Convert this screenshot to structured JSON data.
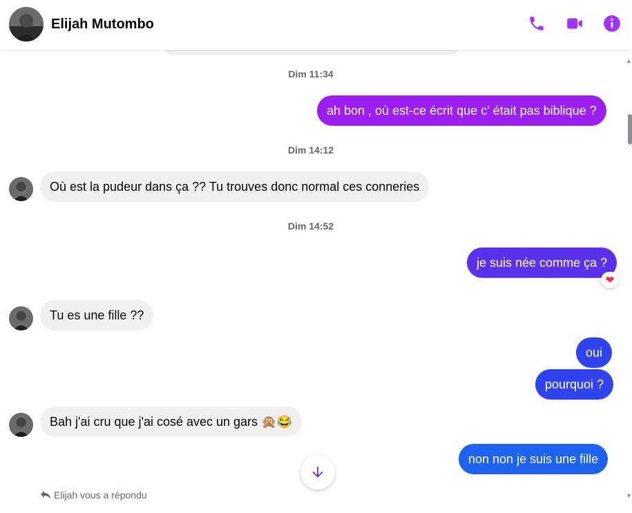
{
  "header": {
    "contact_name": "Elijah Mutombo",
    "accent_color": "#a033ff"
  },
  "messages": [
    {
      "kind": "timestamp",
      "text": "Dim 11:34"
    },
    {
      "kind": "out",
      "text": "ah bon , où est-ce écrit que c' était pas biblique ?",
      "color": "#9d1ef0"
    },
    {
      "kind": "timestamp",
      "text": "Dim 14:12"
    },
    {
      "kind": "in",
      "text": "Où est la pudeur dans ça ?? Tu trouves donc normal ces conneries"
    },
    {
      "kind": "timestamp",
      "text": "Dim 14:52"
    },
    {
      "kind": "out",
      "text": "je suis née comme ça ?",
      "color": "#5b31ee",
      "reaction": "heart"
    },
    {
      "kind": "in",
      "text": "Tu es une fille ??"
    },
    {
      "kind": "out",
      "text": "oui",
      "color": "#2f44f0"
    },
    {
      "kind": "out",
      "text": "pourquoi ?",
      "color": "#2f44f0"
    },
    {
      "kind": "in",
      "text": "Bah j'ai cru que j'ai cosé avec un gars",
      "emojis": "🙊😂"
    },
    {
      "kind": "out",
      "text": "non non je suis une fille",
      "color": "#1d63ee"
    }
  ],
  "footer": {
    "replied_text": "Elijah vous a répondu"
  }
}
